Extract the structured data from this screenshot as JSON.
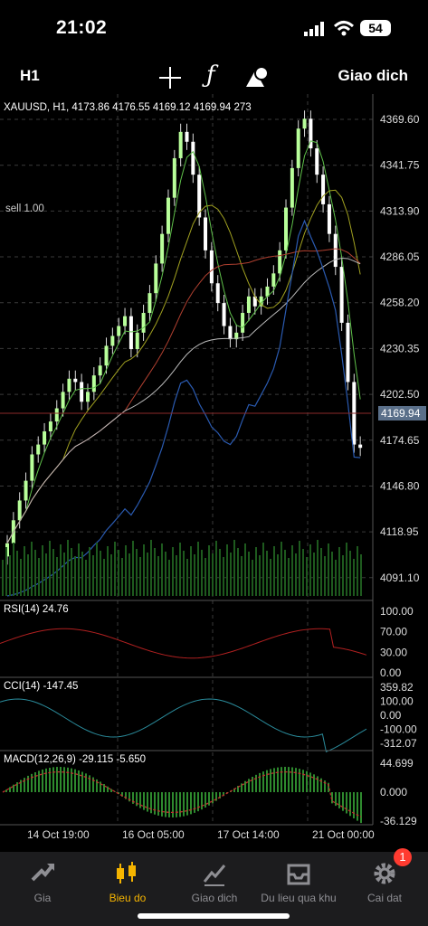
{
  "status_bar": {
    "time": "21:02",
    "battery": "54"
  },
  "toolbar": {
    "timeframe": "H1",
    "trade_label": "Giao dich"
  },
  "chart_data": {
    "type": "candlestick",
    "symbol_header": "XAUUSD, H1, 4173.86 4176.55 4169.12 4169.94 273",
    "order_label": "sell 1.00",
    "last_price": "4169.94",
    "y_ticks": [
      "4369.60",
      "4341.75",
      "4313.90",
      "4286.05",
      "4258.20",
      "4230.35",
      "4202.50",
      "4174.65",
      "4146.80",
      "4118.95",
      "4091.10"
    ],
    "x_labels": [
      "14 Oct 19:00",
      "16 Oct 05:00",
      "17 Oct 14:00",
      "21 Oct 00:00"
    ],
    "ylim": [
      4080,
      4385
    ],
    "close_series": [
      4112,
      4126,
      4138,
      4150,
      4166,
      4172,
      4180,
      4186,
      4194,
      4204,
      4212,
      4210,
      4198,
      4204,
      4214,
      4220,
      4232,
      4238,
      4244,
      4250,
      4230,
      4240,
      4252,
      4264,
      4282,
      4300,
      4322,
      4346,
      4362,
      4356,
      4336,
      4310,
      4290,
      4270,
      4258,
      4244,
      4236,
      4240,
      4252,
      4262,
      4256,
      4262,
      4268,
      4276,
      4290,
      4316,
      4340,
      4364,
      4370,
      4352,
      4336,
      4318,
      4300,
      4280,
      4246,
      4210,
      4172,
      4170
    ]
  },
  "rsi": {
    "label": "RSI(14) 24.76",
    "ticks": [
      "100.00",
      "70.00",
      "30.00",
      "0.00"
    ]
  },
  "cci": {
    "label": "CCI(14) -147.45",
    "ticks": [
      "359.82",
      "100.00",
      "0.00",
      "-100.00",
      "-312.07"
    ]
  },
  "macd": {
    "label": "MACD(12,26,9) -29.115 -5.650",
    "ticks": [
      "44.699",
      "0.000",
      "-36.129"
    ]
  },
  "tabs": [
    {
      "label": "Gia"
    },
    {
      "label": "Bieu do"
    },
    {
      "label": "Giao dich"
    },
    {
      "label": "Du lieu qua khu"
    },
    {
      "label": "Cai dat",
      "badge": "1"
    }
  ]
}
